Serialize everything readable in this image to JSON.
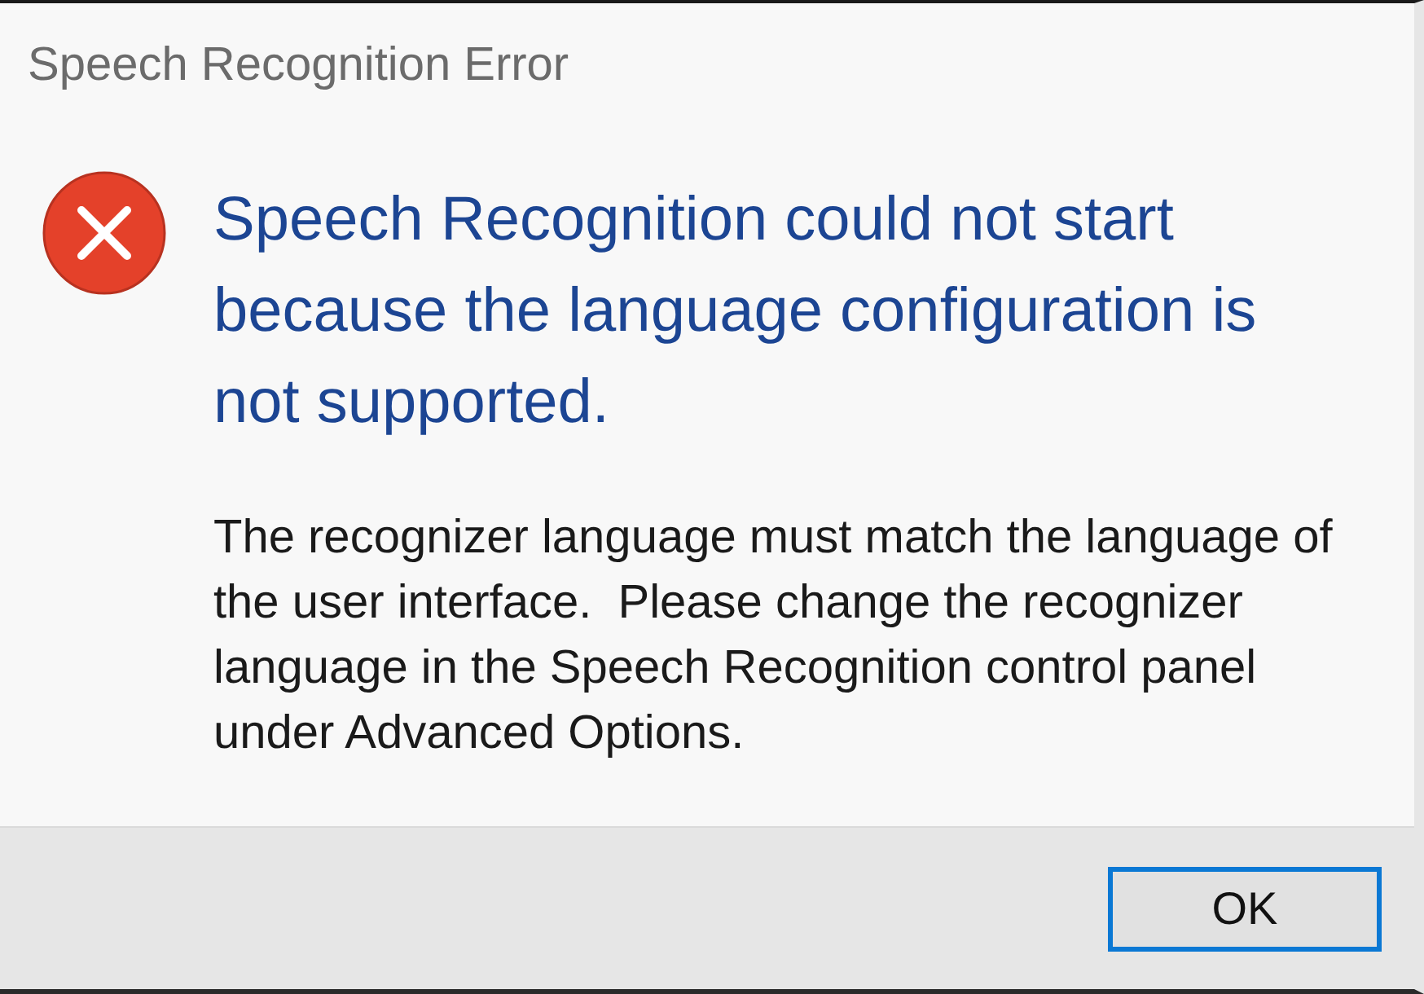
{
  "window": {
    "title": "Speech Recognition Error"
  },
  "message": {
    "kind": "error",
    "main_instruction": "Speech Recognition could not start because the language configuration is not supported.",
    "content": "The recognizer language must match the language of the user interface.  Please change the recognizer language in the Speech Recognition control panel under Advanced Options."
  },
  "buttons": [
    {
      "label": "OK",
      "default": true
    }
  ]
}
